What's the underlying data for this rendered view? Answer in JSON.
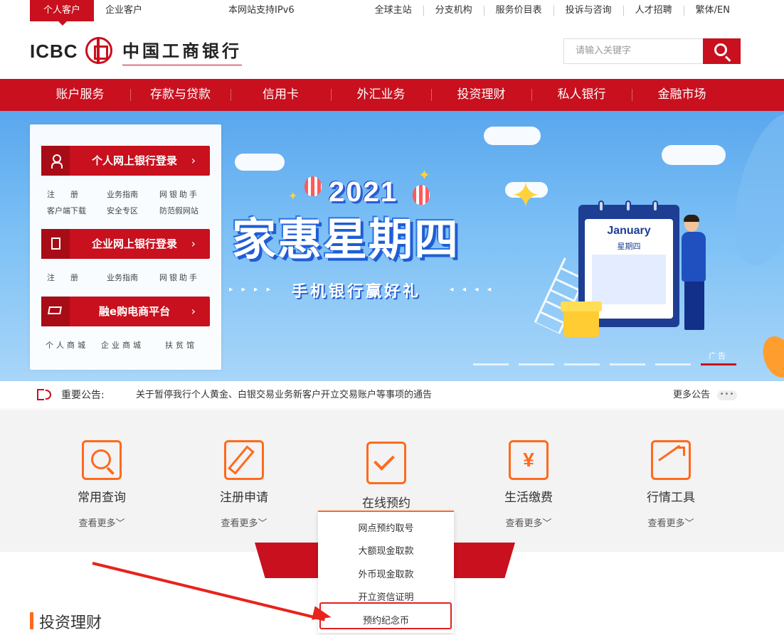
{
  "topbar": {
    "tabs": [
      "个人客户",
      "企业客户"
    ],
    "ipv6": "本网站支持IPv6",
    "links": [
      "全球主站",
      "分支机构",
      "服务价目表",
      "投诉与咨询",
      "人才招聘",
      "繁体/EN"
    ]
  },
  "header": {
    "logo_text": "ICBC",
    "logo_cn": "中国工商银行",
    "search_placeholder": "请输入关键字"
  },
  "nav": [
    "账户服务",
    "存款与贷款",
    "信用卡",
    "外汇业务",
    "投资理财",
    "私人银行",
    "金融市场"
  ],
  "banner": {
    "year": "2021",
    "title": "家惠星期四",
    "subtitle": "手机银行赢好礼",
    "calendar_month": "January",
    "calendar_day": "星期四",
    "ad_label": "广告",
    "slide_count": 6,
    "active_slide": 6
  },
  "panel": {
    "personal": {
      "label": "个人网上银行登录",
      "links": [
        "注　　册",
        "业务指南",
        "网银助手",
        "客户端下载",
        "安全专区",
        "防范假网站"
      ]
    },
    "corporate": {
      "label": "企业网上银行登录",
      "links": [
        "注　　册",
        "业务指南",
        "网银助手"
      ]
    },
    "ecommerce": {
      "label": "融e购电商平台",
      "links": [
        "个人商城",
        "企业商城",
        "扶贫馆"
      ]
    },
    "arrow": "›"
  },
  "notice": {
    "label": "重要公告:",
    "text": "关于暂停我行个人黄金、白银交易业务新客户开立交易账户等事项的通告",
    "more": "更多公告",
    "dots": "•••"
  },
  "services": [
    {
      "name": "常用查询",
      "more": "查看更多﹀"
    },
    {
      "name": "注册申请",
      "more": "查看更多﹀"
    },
    {
      "name": "在线预约",
      "more": ""
    },
    {
      "name": "生活缴费",
      "more": "查看更多﹀",
      "icon_glyph": "¥"
    },
    {
      "name": "行情工具",
      "more": "查看更多﹀"
    }
  ],
  "dropdown": [
    "网点预约取号",
    "大额现金取款",
    "外币现金取款",
    "开立资信证明",
    "预约纪念币"
  ],
  "section_title": "投资理财",
  "colors": {
    "brand_red": "#c8101e",
    "accent_orange": "#ff6a1e",
    "annotation_red": "#e8231c"
  }
}
